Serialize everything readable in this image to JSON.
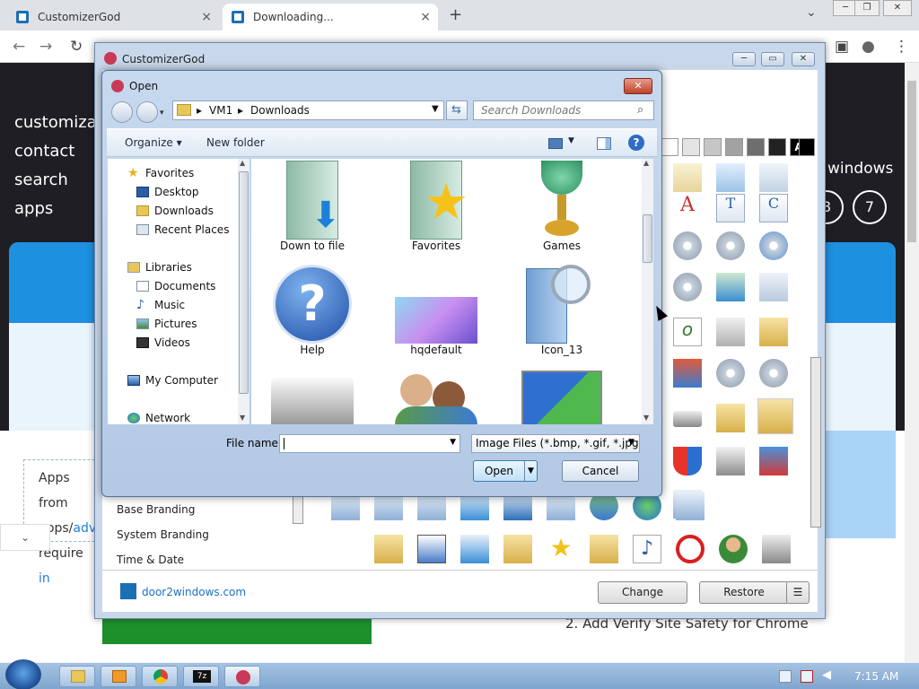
{
  "browser": {
    "tabs": [
      {
        "title": "CustomizerGod",
        "close": "×"
      },
      {
        "title": "Downloading...",
        "close": "×"
      }
    ],
    "new_tab": "+",
    "menu_chevron": "⌄",
    "win_min": "─",
    "win_max": "❐",
    "win_close": "✕"
  },
  "page": {
    "nav_links": [
      "customizat",
      "contact",
      "search",
      "apps"
    ],
    "windows_word": "windows",
    "circle_numbers": [
      "8",
      "7"
    ],
    "textbox_lines": [
      "Apps from",
      "apps/",
      "adv",
      "require ",
      "in"
    ],
    "step2": "2. Add Verify Site Safety for Chrome"
  },
  "customizergod": {
    "title": "CustomizerGod",
    "sidebar_items": [
      "Base Branding",
      "System Branding",
      "Time & Date"
    ],
    "link_text": "door2windows.com",
    "change_label": "Change",
    "restore_label": "Restore",
    "menu_label": "☰",
    "swatch_letter": "A"
  },
  "open_dialog": {
    "title": "Open",
    "close_label": "✕",
    "breadcrumb": [
      "VM1",
      "Downloads"
    ],
    "search_placeholder": "Search Downloads",
    "organize_label": "Organize ▾",
    "new_folder_label": "New folder",
    "help_label": "?",
    "nav_items": {
      "favorites": "Favorites",
      "desktop": "Desktop",
      "downloads": "Downloads",
      "recent": "Recent Places",
      "libraries": "Libraries",
      "documents": "Documents",
      "music": "Music",
      "pictures": "Pictures",
      "videos": "Videos",
      "my_computer": "My Computer",
      "network": "Network"
    },
    "files": [
      "Down to file",
      "Favorites",
      "Games",
      "Help",
      "hqdefault",
      "Icon_13"
    ],
    "file_name_label": "File name:",
    "file_name_value": "",
    "file_type": "Image Files (*.bmp, *.gif, *.jpg,",
    "open_label": "Open",
    "cancel_label": "Cancel"
  },
  "taskbar": {
    "clock": "7:15 AM",
    "app_7z_label": "7z"
  }
}
